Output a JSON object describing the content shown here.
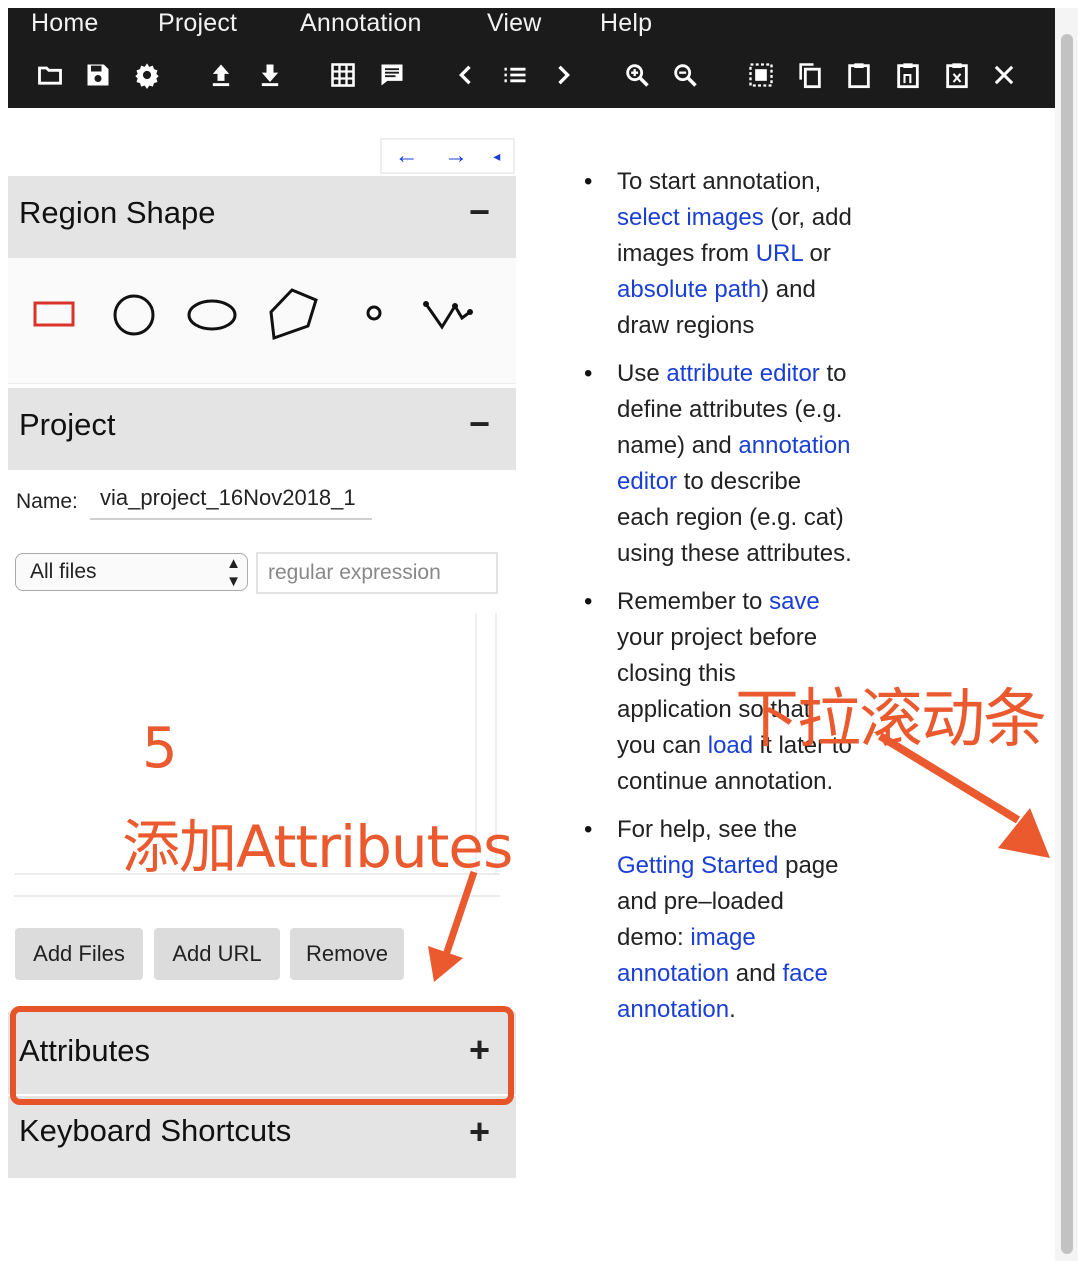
{
  "menu": {
    "items": [
      "Home",
      "Project",
      "Annotation",
      "View",
      "Help"
    ]
  },
  "toolbar": {
    "icons": [
      "folder-open-icon",
      "save-icon",
      "settings-icon",
      "upload-icon",
      "download-icon",
      "grid-view-icon",
      "comment-icon",
      "prev-icon",
      "list-icon",
      "next-icon",
      "zoom-in-icon",
      "zoom-out-icon",
      "select-all-icon",
      "copy-icon",
      "paste-icon",
      "paste-n-icon",
      "paste-delete-icon",
      "close-icon"
    ]
  },
  "panel_nav": {
    "left": "←",
    "right": "→",
    "collapse": "◂"
  },
  "region_shape": {
    "title": "Region Shape",
    "toggle": "−",
    "shapes": [
      "rectangle",
      "circle",
      "ellipse",
      "polygon",
      "point",
      "polyline"
    ]
  },
  "project": {
    "title": "Project",
    "toggle": "−",
    "name_label": "Name:",
    "name_value": "via_project_16Nov2018_1",
    "filter_selected": "All files",
    "regex_placeholder": "regular expression",
    "buttons": {
      "add_files": "Add Files",
      "add_url": "Add URL",
      "remove": "Remove"
    }
  },
  "attributes": {
    "title": "Attributes",
    "toggle": "+"
  },
  "keyboard_shortcuts": {
    "title": "Keyboard Shortcuts",
    "toggle": "+"
  },
  "help": {
    "item1": {
      "t1": "To start annotation,",
      "l1": "select images",
      "t2": "(or, add images from",
      "l2": "URL",
      "t3": "or",
      "l3": "absolute path",
      "t4": ") and draw regions"
    },
    "item2": {
      "t1": "Use",
      "l1": "attribute editor",
      "t2": "to define attributes (e.g. name) and",
      "l2": "annotation editor",
      "t3": "to describe each region (e.g. cat) using these attributes."
    },
    "item3": {
      "t1": "Remember to",
      "l1": "save",
      "t2": "your project before closing this application so that you can",
      "l2": "load",
      "t3": "it later to continue annotation."
    },
    "item4": {
      "t1": "For help, see the",
      "l1": "Getting Started",
      "t2": "page and pre–loaded demo:",
      "l2": "image annotation",
      "t3": "and",
      "l3": "face annotation",
      "t4": "."
    }
  },
  "annotations": {
    "step_number": "5",
    "add_attributes": "添加Attributes",
    "scroll_hint": "下拉滚动条"
  },
  "colors": {
    "topbar": "#1b1b1b",
    "link": "#1a3fd6",
    "section_bg": "#e4e4e4",
    "annotation": "#ea5a2e",
    "rect_tool": "#d9342b"
  }
}
